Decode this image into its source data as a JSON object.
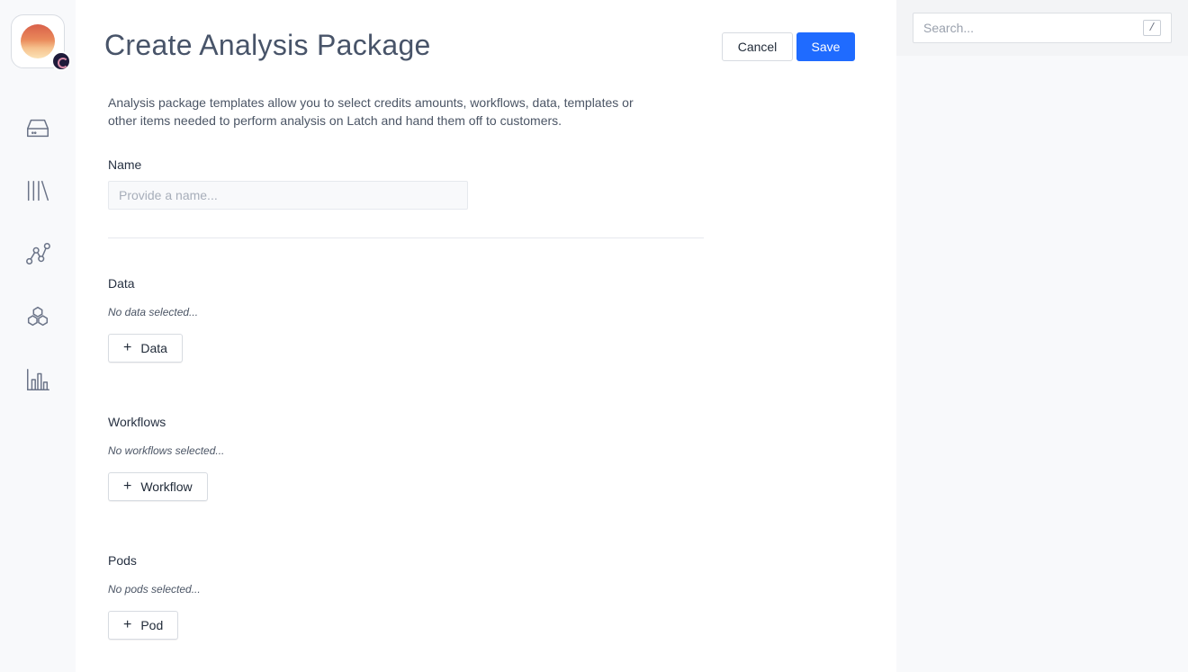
{
  "sidebar": {
    "logo": {
      "name": "sunset-logo",
      "badge": "status-badge-icon"
    },
    "items": [
      {
        "icon": "drive-icon"
      },
      {
        "icon": "library-icon"
      },
      {
        "icon": "workflow-graph-icon"
      },
      {
        "icon": "pods-hexagon-icon"
      },
      {
        "icon": "bar-chart-icon"
      }
    ]
  },
  "header": {
    "title": "Create Analysis Package",
    "cancel_label": "Cancel",
    "save_label": "Save"
  },
  "form": {
    "description": "Analysis package templates allow you to select credits amounts, workflows, data, templates or other items needed to perform analysis on Latch and hand them off to customers.",
    "name": {
      "label": "Name",
      "value": "",
      "placeholder": "Provide a name..."
    },
    "sections": {
      "data": {
        "label": "Data",
        "empty_text": "No data selected...",
        "add_label": "Data"
      },
      "workflows": {
        "label": "Workflows",
        "empty_text": "No workflows selected...",
        "add_label": "Workflow"
      },
      "pods": {
        "label": "Pods",
        "empty_text": "No pods selected...",
        "add_label": "Pod"
      }
    }
  },
  "search": {
    "placeholder": "Search...",
    "shortcut": "/"
  },
  "colors": {
    "primary": "#1f6bff",
    "title": "#485469",
    "sidebar_bg": "#f8f9fb"
  }
}
